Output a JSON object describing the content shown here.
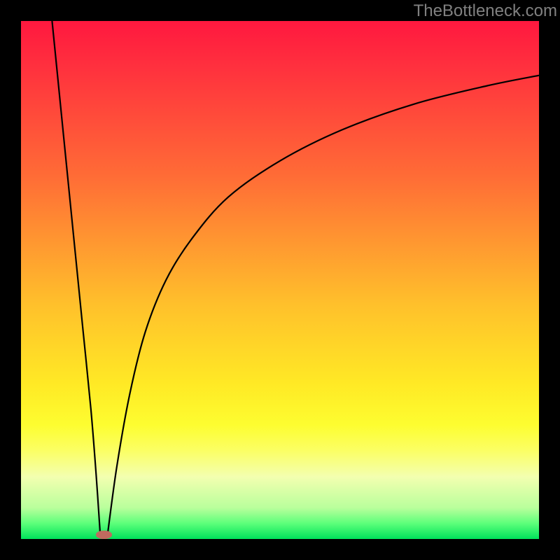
{
  "watermark": "TheBottleneck.com",
  "chart_data": {
    "type": "line",
    "title": "",
    "xlabel": "",
    "ylabel": "",
    "xlim": [
      0,
      100
    ],
    "ylim": [
      0,
      100
    ],
    "grid": false,
    "legend": false,
    "background_gradient": {
      "direction": "vertical",
      "stops": [
        {
          "pos": 0,
          "color": "#ff183f"
        },
        {
          "pos": 30,
          "color": "#ff6c36"
        },
        {
          "pos": 55,
          "color": "#ffc12b"
        },
        {
          "pos": 78,
          "color": "#fdfd30"
        },
        {
          "pos": 94,
          "color": "#b9ff9c"
        },
        {
          "pos": 100,
          "color": "#00e25b"
        }
      ]
    },
    "series": [
      {
        "name": "left-branch",
        "x": [
          6.0,
          7.5,
          9.0,
          10.5,
          12.0,
          13.5,
          14.5,
          15.3
        ],
        "y": [
          100,
          85,
          70,
          55,
          40,
          25,
          12.5,
          0.8
        ]
      },
      {
        "name": "right-branch",
        "x": [
          16.7,
          18.5,
          21,
          24,
          28,
          33,
          40,
          50,
          62,
          76,
          90,
          100
        ],
        "y": [
          0.8,
          14,
          28,
          40,
          50,
          58,
          66,
          73,
          79,
          84,
          87.5,
          89.5
        ]
      }
    ],
    "marker": {
      "x": 16,
      "y": 0.8,
      "width_pct": 3.2,
      "height_pct": 1.6,
      "color": "#c06a5f"
    }
  }
}
